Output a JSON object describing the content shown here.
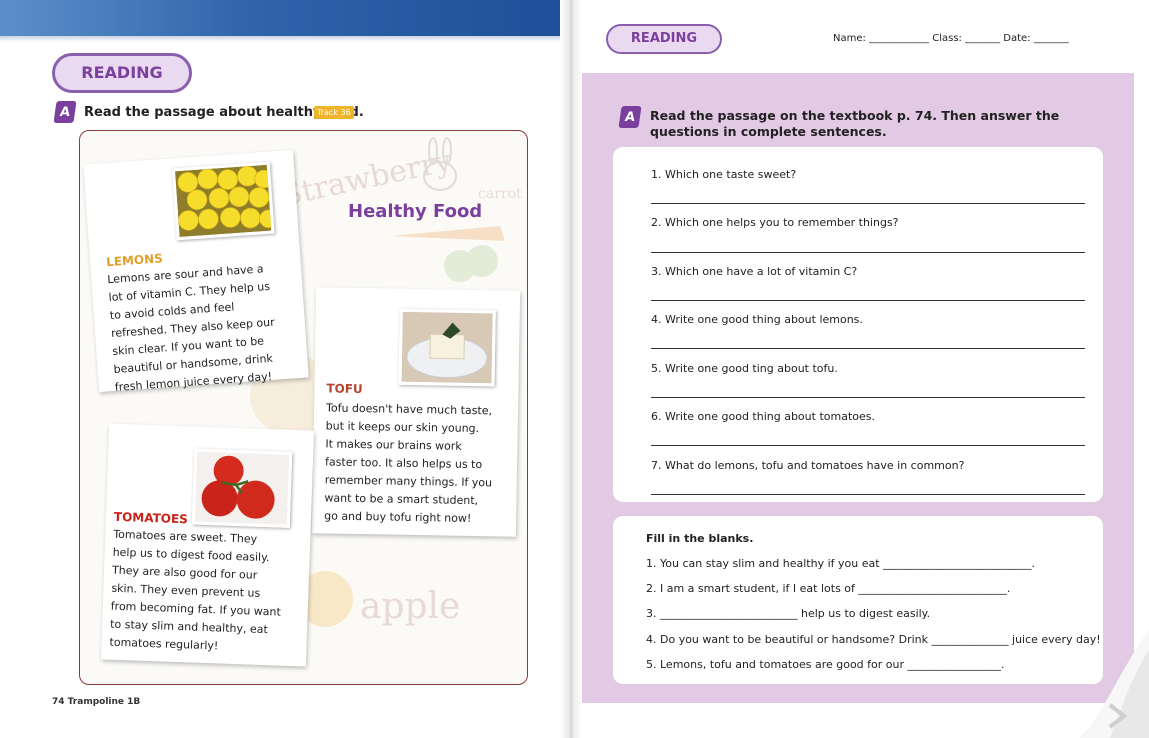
{
  "left": {
    "section_label": "READING",
    "badge": "A",
    "instruction": "Read the passage about healthy food.",
    "track": "Track 36",
    "panel_title": "Healthy Food",
    "watermarks": [
      "Strawberry",
      "carrot",
      "apple"
    ],
    "cards": {
      "lemons": {
        "heading": "LEMONS",
        "lines": [
          "Lemons are sour and have a",
          "lot of vitamin C. They help us",
          "to avoid colds and feel",
          "refreshed. They also keep our",
          "skin clear. If you want to be",
          "beautiful or handsome, drink",
          "fresh lemon juice every day!"
        ]
      },
      "tofu": {
        "heading": "TOFU",
        "lines": [
          "Tofu doesn't have much taste,",
          "but it keeps our skin young.",
          "It makes our brains work",
          "faster too. It also helps us to",
          "remember many things. If you",
          "want to be a smart student,",
          "go and buy tofu right now!"
        ]
      },
      "tomatoes": {
        "heading": "TOMATOES",
        "lines": [
          "Tomatoes are sweet. They",
          "help us to digest food easily.",
          "They are also good for our",
          "skin. They even prevent us",
          "from becoming fat. If you want",
          "to stay slim and healthy, eat",
          "tomatoes regularly!"
        ]
      }
    },
    "footer": "74 Trampoline 1B"
  },
  "right": {
    "section_label": "READING",
    "header_fields": "Name: ____________ Class: _______ Date: _______",
    "badge": "A",
    "instruction": "Read the passage on the textbook p. 74. Then answer the questions in complete sentences.",
    "questions": [
      "1. Which one taste sweet?",
      "2. Which one helps you to remember things?",
      "3. Which one have a lot of vitamin C?",
      "4. Write one good thing about lemons.",
      "5. Write one good ting about tofu.",
      "6. Write one good thing about tomatoes.",
      "7. What do lemons, tofu and tomatoes have in common?"
    ],
    "fill_title": "Fill in the blanks.",
    "fill_items": [
      "1.  You can stay slim and healthy if you eat ___________________________.",
      "2.  I am a smart student, if I eat lots of ___________________________.",
      "3.  _________________________ help us to digest easily.",
      "4.  Do you want to be beautiful or handsome? Drink ______________ juice every day!",
      "5.  Lemons, tofu and tomatoes are good for our _________________."
    ]
  },
  "colors": {
    "accent_purple": "#7b3f9e",
    "lavender": "#e2c9e4",
    "blue_band": "#2f63aa",
    "panel_border": "#8c3b3b"
  }
}
